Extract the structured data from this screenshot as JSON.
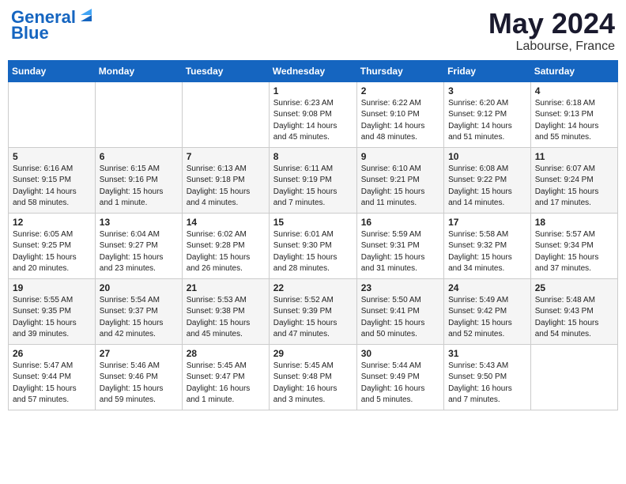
{
  "header": {
    "logo_line1": "General",
    "logo_line2": "Blue",
    "title": "May 2024",
    "location": "Labourse, France"
  },
  "days_of_week": [
    "Sunday",
    "Monday",
    "Tuesday",
    "Wednesday",
    "Thursday",
    "Friday",
    "Saturday"
  ],
  "weeks": [
    [
      {
        "day": "",
        "info": ""
      },
      {
        "day": "",
        "info": ""
      },
      {
        "day": "",
        "info": ""
      },
      {
        "day": "1",
        "info": "Sunrise: 6:23 AM\nSunset: 9:08 PM\nDaylight: 14 hours\nand 45 minutes."
      },
      {
        "day": "2",
        "info": "Sunrise: 6:22 AM\nSunset: 9:10 PM\nDaylight: 14 hours\nand 48 minutes."
      },
      {
        "day": "3",
        "info": "Sunrise: 6:20 AM\nSunset: 9:12 PM\nDaylight: 14 hours\nand 51 minutes."
      },
      {
        "day": "4",
        "info": "Sunrise: 6:18 AM\nSunset: 9:13 PM\nDaylight: 14 hours\nand 55 minutes."
      }
    ],
    [
      {
        "day": "5",
        "info": "Sunrise: 6:16 AM\nSunset: 9:15 PM\nDaylight: 14 hours\nand 58 minutes."
      },
      {
        "day": "6",
        "info": "Sunrise: 6:15 AM\nSunset: 9:16 PM\nDaylight: 15 hours\nand 1 minute."
      },
      {
        "day": "7",
        "info": "Sunrise: 6:13 AM\nSunset: 9:18 PM\nDaylight: 15 hours\nand 4 minutes."
      },
      {
        "day": "8",
        "info": "Sunrise: 6:11 AM\nSunset: 9:19 PM\nDaylight: 15 hours\nand 7 minutes."
      },
      {
        "day": "9",
        "info": "Sunrise: 6:10 AM\nSunset: 9:21 PM\nDaylight: 15 hours\nand 11 minutes."
      },
      {
        "day": "10",
        "info": "Sunrise: 6:08 AM\nSunset: 9:22 PM\nDaylight: 15 hours\nand 14 minutes."
      },
      {
        "day": "11",
        "info": "Sunrise: 6:07 AM\nSunset: 9:24 PM\nDaylight: 15 hours\nand 17 minutes."
      }
    ],
    [
      {
        "day": "12",
        "info": "Sunrise: 6:05 AM\nSunset: 9:25 PM\nDaylight: 15 hours\nand 20 minutes."
      },
      {
        "day": "13",
        "info": "Sunrise: 6:04 AM\nSunset: 9:27 PM\nDaylight: 15 hours\nand 23 minutes."
      },
      {
        "day": "14",
        "info": "Sunrise: 6:02 AM\nSunset: 9:28 PM\nDaylight: 15 hours\nand 26 minutes."
      },
      {
        "day": "15",
        "info": "Sunrise: 6:01 AM\nSunset: 9:30 PM\nDaylight: 15 hours\nand 28 minutes."
      },
      {
        "day": "16",
        "info": "Sunrise: 5:59 AM\nSunset: 9:31 PM\nDaylight: 15 hours\nand 31 minutes."
      },
      {
        "day": "17",
        "info": "Sunrise: 5:58 AM\nSunset: 9:32 PM\nDaylight: 15 hours\nand 34 minutes."
      },
      {
        "day": "18",
        "info": "Sunrise: 5:57 AM\nSunset: 9:34 PM\nDaylight: 15 hours\nand 37 minutes."
      }
    ],
    [
      {
        "day": "19",
        "info": "Sunrise: 5:55 AM\nSunset: 9:35 PM\nDaylight: 15 hours\nand 39 minutes."
      },
      {
        "day": "20",
        "info": "Sunrise: 5:54 AM\nSunset: 9:37 PM\nDaylight: 15 hours\nand 42 minutes."
      },
      {
        "day": "21",
        "info": "Sunrise: 5:53 AM\nSunset: 9:38 PM\nDaylight: 15 hours\nand 45 minutes."
      },
      {
        "day": "22",
        "info": "Sunrise: 5:52 AM\nSunset: 9:39 PM\nDaylight: 15 hours\nand 47 minutes."
      },
      {
        "day": "23",
        "info": "Sunrise: 5:50 AM\nSunset: 9:41 PM\nDaylight: 15 hours\nand 50 minutes."
      },
      {
        "day": "24",
        "info": "Sunrise: 5:49 AM\nSunset: 9:42 PM\nDaylight: 15 hours\nand 52 minutes."
      },
      {
        "day": "25",
        "info": "Sunrise: 5:48 AM\nSunset: 9:43 PM\nDaylight: 15 hours\nand 54 minutes."
      }
    ],
    [
      {
        "day": "26",
        "info": "Sunrise: 5:47 AM\nSunset: 9:44 PM\nDaylight: 15 hours\nand 57 minutes."
      },
      {
        "day": "27",
        "info": "Sunrise: 5:46 AM\nSunset: 9:46 PM\nDaylight: 15 hours\nand 59 minutes."
      },
      {
        "day": "28",
        "info": "Sunrise: 5:45 AM\nSunset: 9:47 PM\nDaylight: 16 hours\nand 1 minute."
      },
      {
        "day": "29",
        "info": "Sunrise: 5:45 AM\nSunset: 9:48 PM\nDaylight: 16 hours\nand 3 minutes."
      },
      {
        "day": "30",
        "info": "Sunrise: 5:44 AM\nSunset: 9:49 PM\nDaylight: 16 hours\nand 5 minutes."
      },
      {
        "day": "31",
        "info": "Sunrise: 5:43 AM\nSunset: 9:50 PM\nDaylight: 16 hours\nand 7 minutes."
      },
      {
        "day": "",
        "info": ""
      }
    ]
  ]
}
